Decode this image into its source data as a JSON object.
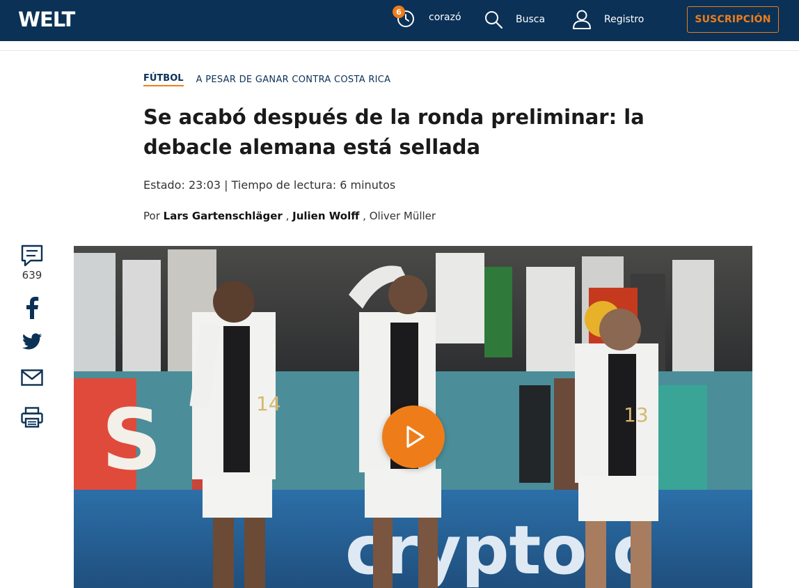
{
  "header": {
    "logo": "WELT",
    "history_count": "6",
    "history_label": "corazón",
    "search_label": "Busca",
    "register_label": "Registro",
    "subscribe_label": "SUSCRIPCIÓN"
  },
  "article": {
    "section": "FÚTBOL",
    "topic": "A PESAR DE GANAR CONTRA COSTA RICA",
    "headline": "Se acabó después de la ronda preliminar: la debacle alemana está sellada",
    "meta": "Estado: 23:03 | Tiempo de lectura: 6 minutos",
    "by_prefix": "Por",
    "authors": [
      "Lars Gartenschläger",
      "Julien Wolff",
      "Oliver Müller"
    ],
    "separator": ","
  },
  "share": {
    "comment_count": "639"
  },
  "hero": {
    "jersey_numbers": [
      "14",
      "13"
    ],
    "banner_text": "crypto.c"
  },
  "colors": {
    "navy": "#0b3156",
    "accent": "#ee7d19"
  },
  "icons": [
    "history-icon",
    "search-icon",
    "user-icon",
    "comment-icon",
    "facebook-icon",
    "twitter-icon",
    "mail-icon",
    "print-icon",
    "play-icon"
  ]
}
